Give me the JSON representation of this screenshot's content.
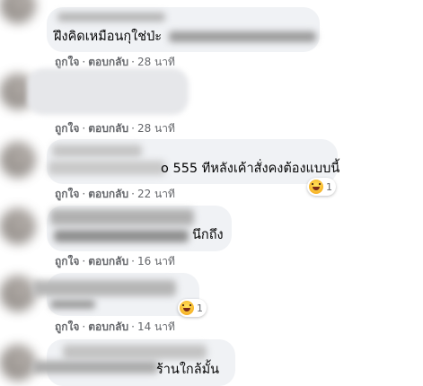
{
  "actions": {
    "like": "ถูกใจ",
    "reply": "ตอบกลับ",
    "separator": "·"
  },
  "comments": [
    {
      "text": "ฝึงคิดเหมือนกุใช่ป่ะ",
      "time": "28 นาที"
    },
    {
      "text": "",
      "time": "28 นาที"
    },
    {
      "text": "o 555 ทีหลังเค้าสั่งคงต้องแบบนี้",
      "time": "22 นาที",
      "reaction_count": "1"
    },
    {
      "text": "นึกถึง",
      "time": "16 นาที"
    },
    {
      "text": "",
      "time": "14 นาที",
      "reaction_count": "1"
    },
    {
      "text": "ร้านใกล้มั้น"
    }
  ],
  "colors": {
    "bubble": "#f0f2f5",
    "secondary_text": "#65676b",
    "text": "#050505"
  }
}
